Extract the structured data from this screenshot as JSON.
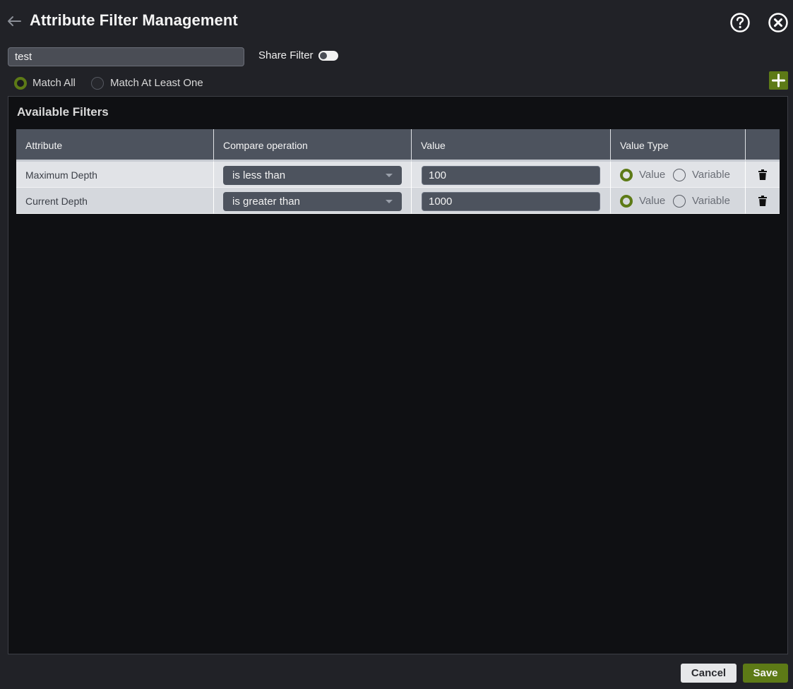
{
  "header": {
    "title": "Attribute Filter Management",
    "back_icon": "back-arrow-icon",
    "help_icon": "help-circle-icon",
    "close_icon": "close-circle-icon"
  },
  "filter": {
    "name_value": "test",
    "share_label": "Share Filter",
    "share_enabled": false
  },
  "match": {
    "options": [
      {
        "label": "Match All",
        "selected": true
      },
      {
        "label": "Match At Least One",
        "selected": false
      }
    ]
  },
  "add_button_icon": "plus-icon",
  "panel": {
    "title": "Available Filters",
    "columns": [
      "Attribute",
      "Compare operation",
      "Value",
      "Value Type",
      ""
    ],
    "rows": [
      {
        "attribute": "Maximum Depth",
        "operation": "is less than",
        "value": "100",
        "value_type_options": [
          "Value",
          "Variable"
        ],
        "value_type_selected": "Value"
      },
      {
        "attribute": "Current Depth",
        "operation": "is greater than",
        "value": "1000",
        "value_type_options": [
          "Value",
          "Variable"
        ],
        "value_type_selected": "Value"
      }
    ]
  },
  "footer": {
    "cancel_label": "Cancel",
    "save_label": "Save"
  },
  "colors": {
    "accent": "#5d7a16",
    "background": "#212227",
    "panel": "#0f1013",
    "header_row": "#4d535e"
  }
}
